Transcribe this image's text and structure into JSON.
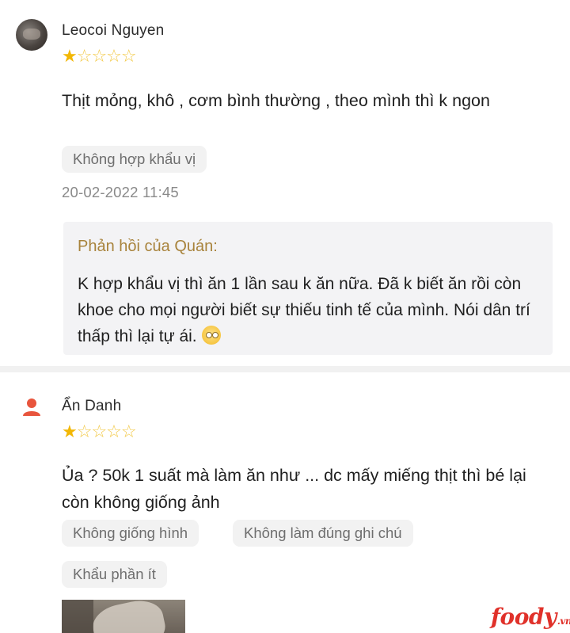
{
  "reviews": [
    {
      "username": "Leocoi Nguyen",
      "rating": 1,
      "rating_max": 5,
      "stars_filled": "★",
      "stars_empty": "☆☆☆☆",
      "comment": "Thịt mỏng, khô , cơm bình thường , theo mình thì k ngon",
      "tags": [
        "Không hợp khẩu vị"
      ],
      "timestamp": "20-02-2022 11:45",
      "reply": {
        "title": "Phản hồi của Quán:",
        "text": "K hợp khẩu vị thì ăn 1 lần sau k ăn nữa. Đã k biết ăn rồi còn khoe cho mọi người biết sự thiếu tinh tế của mình. Nói dân trí thấp thì lại tự ái."
      }
    },
    {
      "username": "Ẩn Danh",
      "rating": 1,
      "rating_max": 5,
      "stars_filled": "★",
      "stars_empty": "☆☆☆☆",
      "comment": "Ủa ? 50k 1 suất mà làm ăn như ... dc mấy miếng thịt thì bé lại còn không giống ảnh",
      "tags": [
        "Không giống hình",
        "Không làm đúng ghi chú",
        "Khẩu phần ít"
      ]
    }
  ],
  "logo": {
    "text": "foody",
    "suffix": ".vn"
  },
  "colors": {
    "star": "#f2b705",
    "reply_title": "#a8833c",
    "logo": "#e0312a",
    "tag_bg": "#f2f2f2"
  },
  "icons": {
    "anon_avatar": "person-icon",
    "emoji": "flushed-face-emoji"
  }
}
